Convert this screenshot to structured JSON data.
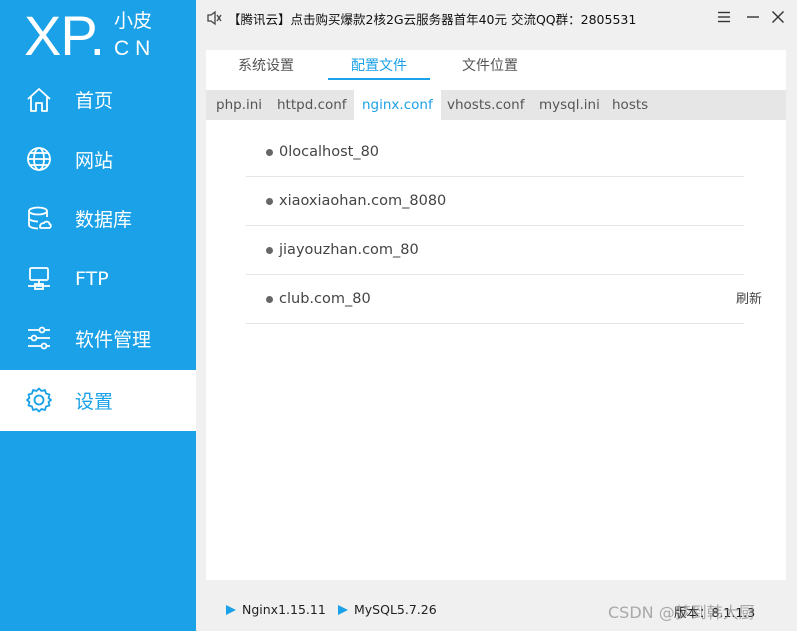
{
  "app": {
    "logo_main": "XP.",
    "logo_top": "小皮",
    "logo_bottom": "CN"
  },
  "sidebar": {
    "items": [
      {
        "label": "首页",
        "icon": "home-icon"
      },
      {
        "label": "网站",
        "icon": "globe-icon"
      },
      {
        "label": "数据库",
        "icon": "database-icon"
      },
      {
        "label": "FTP",
        "icon": "ftp-server-icon"
      },
      {
        "label": "软件管理",
        "icon": "sliders-icon"
      },
      {
        "label": "设置",
        "icon": "gear-icon",
        "active": true
      }
    ]
  },
  "topbar": {
    "announcement": "【腾讯云】点击购买爆款2核2G云服务器首年40元 交流QQ群：2805531",
    "speaker_icon": "speaker-icon",
    "menu_icon": "menu-icon",
    "minimize_icon": "minimize-icon",
    "close_icon": "close-icon"
  },
  "tabs": [
    "系统设置",
    "配置文件",
    "文件位置"
  ],
  "active_tab": "配置文件",
  "subtabs": [
    "php.ini",
    "httpd.conf",
    "nginx.conf",
    "vhosts.conf",
    "mysql.ini",
    "hosts"
  ],
  "active_subtab": "nginx.conf",
  "vhosts": [
    "0localhost_80",
    "xiaoxiaohan.com_8080",
    "jiayouzhan.com_80",
    "club.com_80"
  ],
  "refresh_label": "刷新",
  "statusbar": {
    "services": [
      "Nginx1.15.11",
      "MySQL5.7.26"
    ],
    "version": "版本：8.1.1.3",
    "watermark": "CSDN @梦到韩大厨"
  },
  "colors": {
    "accent": "#1aa1e7",
    "background": "#f0f0f0"
  }
}
